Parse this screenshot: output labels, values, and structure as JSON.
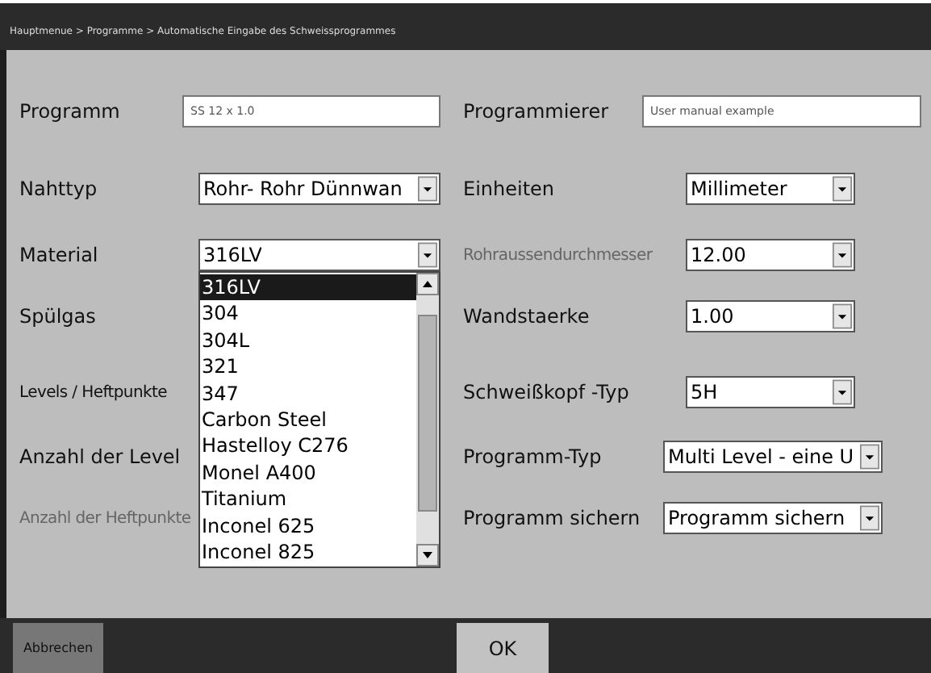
{
  "breadcrumb": "Hauptmenue > Programme > Automatische Eingabe des Schweissprogrammes",
  "rows": [
    {
      "left": {
        "label": "Programm",
        "small": false,
        "dimmed": false,
        "control": {
          "kind": "input",
          "value": "SS 12 x 1.0"
        }
      },
      "right": {
        "label": "Programmierer",
        "small": false,
        "dimmed": false,
        "control": {
          "kind": "input",
          "value": "User manual example"
        }
      }
    },
    {
      "left": {
        "label": "Nahttyp",
        "small": false,
        "dimmed": false,
        "control": {
          "kind": "select",
          "value": "Rohr- Rohr Dünnwan"
        }
      },
      "right": {
        "label": "Einheiten",
        "small": false,
        "dimmed": false,
        "control": {
          "kind": "select",
          "value": "Millimeter"
        }
      }
    },
    {
      "left": {
        "label": "Material",
        "small": false,
        "dimmed": false,
        "control": {
          "kind": "select",
          "value": "316LV"
        }
      },
      "right": {
        "label": "Rohraussendurchmesser",
        "small": true,
        "dimmed": true,
        "control": {
          "kind": "select",
          "value": "12.00"
        }
      }
    },
    {
      "left": {
        "label": "Spülgas",
        "small": false,
        "dimmed": false
      },
      "right": {
        "label": "Wandstaerke",
        "small": false,
        "dimmed": false,
        "control": {
          "kind": "select",
          "value": "1.00"
        }
      }
    },
    {
      "left": {
        "label": "Levels / Heftpunkte",
        "small": true,
        "dimmed": false
      },
      "right": {
        "label": "Schweißkopf -Typ",
        "small": false,
        "dimmed": false,
        "control": {
          "kind": "select",
          "value": "5H"
        }
      }
    },
    {
      "left": {
        "label": "Anzahl der Level",
        "small": false,
        "dimmed": false
      },
      "right": {
        "label": "Programm-Typ",
        "small": false,
        "dimmed": false,
        "control": {
          "kind": "wide-select",
          "value": "Multi Level - eine U"
        }
      }
    },
    {
      "left": {
        "label": "Anzahl der Heftpunkte",
        "small": true,
        "dimmed": true
      },
      "right": {
        "label": "Programm sichern",
        "small": false,
        "dimmed": false,
        "control": {
          "kind": "wide-select",
          "value": "Programm sichern"
        }
      }
    }
  ],
  "material_list": {
    "items": [
      {
        "label": "316LV",
        "selected": true
      },
      {
        "label": "304",
        "selected": false
      },
      {
        "label": "304L",
        "selected": false
      },
      {
        "label": "321",
        "selected": false
      },
      {
        "label": "347",
        "selected": false
      },
      {
        "label": "Carbon Steel",
        "selected": false
      },
      {
        "label": "Hastelloy C276",
        "selected": false
      },
      {
        "label": "Monel A400",
        "selected": false
      },
      {
        "label": "Titanium",
        "selected": false
      },
      {
        "label": "Inconel 625",
        "selected": false
      },
      {
        "label": "Inconel 825",
        "selected": false
      }
    ]
  },
  "buttons": [
    {
      "label": "Abbrechen",
      "kind": "cancel"
    },
    {
      "label": "OK",
      "kind": "ok"
    }
  ]
}
